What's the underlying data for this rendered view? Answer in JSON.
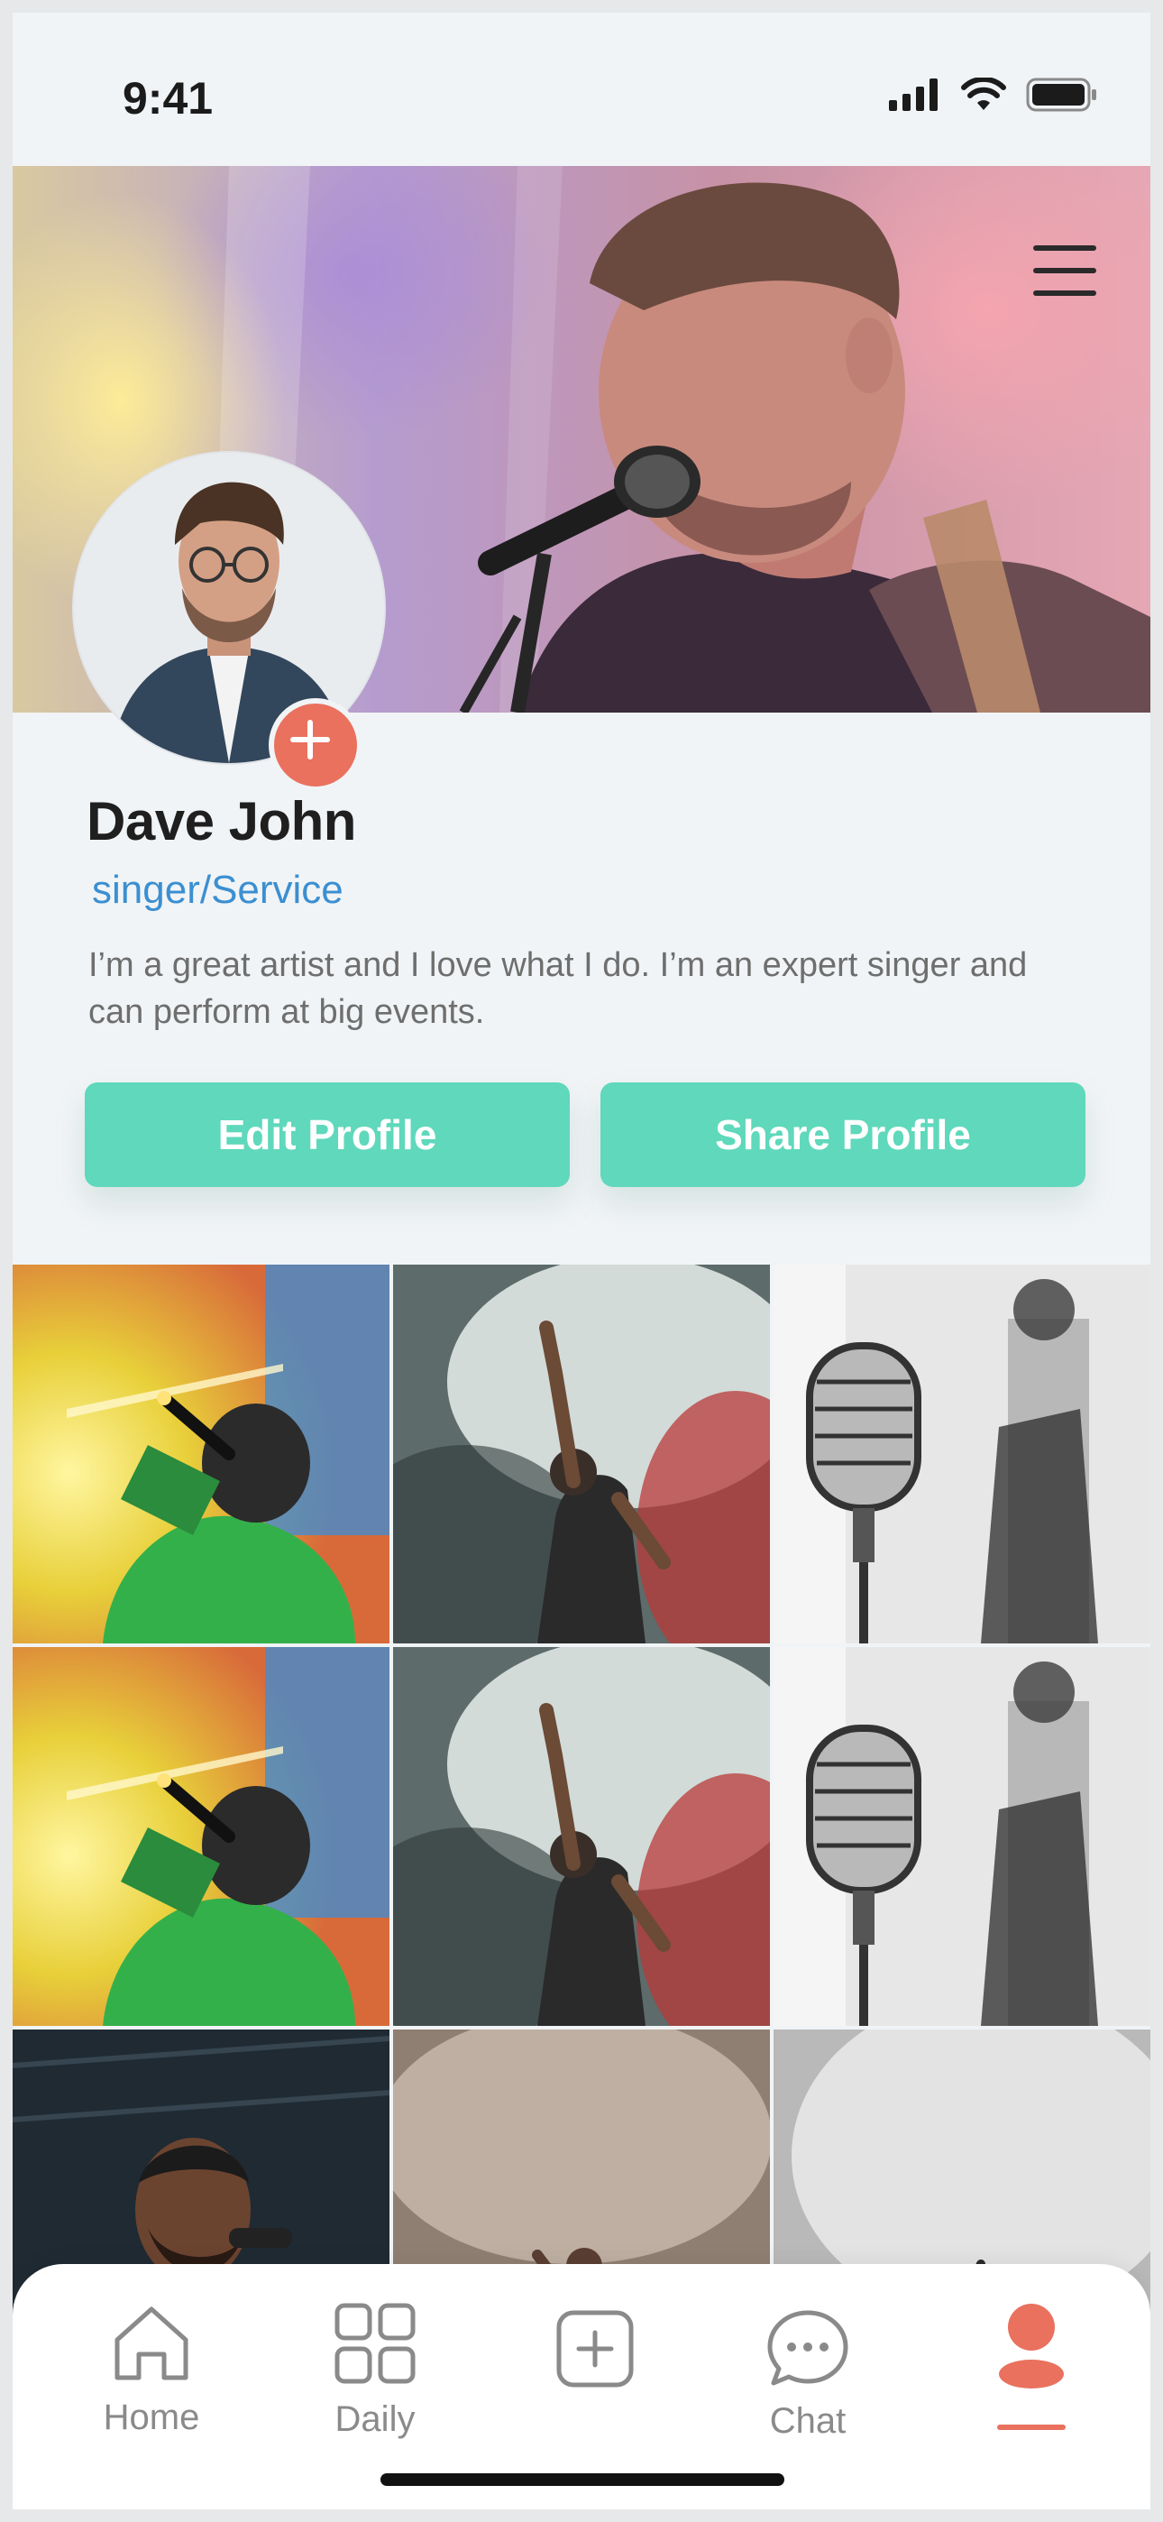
{
  "status_bar": {
    "time": "9:41",
    "icons": [
      "cellular-signal-icon",
      "wifi-icon",
      "battery-icon"
    ]
  },
  "header": {
    "menu_icon": "hamburger-menu-icon"
  },
  "profile": {
    "name": "Dave John",
    "role": "singer/Service",
    "bio": "I’m a great artist and I love what I do. I’m an expert singer and can perform at big events.",
    "add_photo_icon": "plus-icon"
  },
  "actions": {
    "edit_label": "Edit Profile",
    "share_label": "Share Profile"
  },
  "gallery": {
    "photos": [
      "singer-green-spotlight",
      "singer-arm-raised-smoke",
      "vintage-microphone",
      "singer-green-spotlight",
      "singer-arm-raised-smoke",
      "vintage-microphone",
      "singer-laughing-microphone",
      "singer-hazy-stage",
      "crowd-silhouette"
    ]
  },
  "bottom_nav": {
    "items": [
      {
        "label": "Home",
        "icon": "home-icon"
      },
      {
        "label": "Daily",
        "icon": "grid-icon"
      },
      {
        "label": "",
        "icon": "add-post-icon"
      },
      {
        "label": "Chat",
        "icon": "chat-bubble-icon"
      },
      {
        "label": "",
        "icon": "profile-icon"
      }
    ],
    "active_index": 4
  },
  "colors": {
    "accent_green": "#5fd8bb",
    "accent_coral": "#e9715e",
    "link_blue": "#3b8fd1",
    "background": "#f1f4f6"
  }
}
